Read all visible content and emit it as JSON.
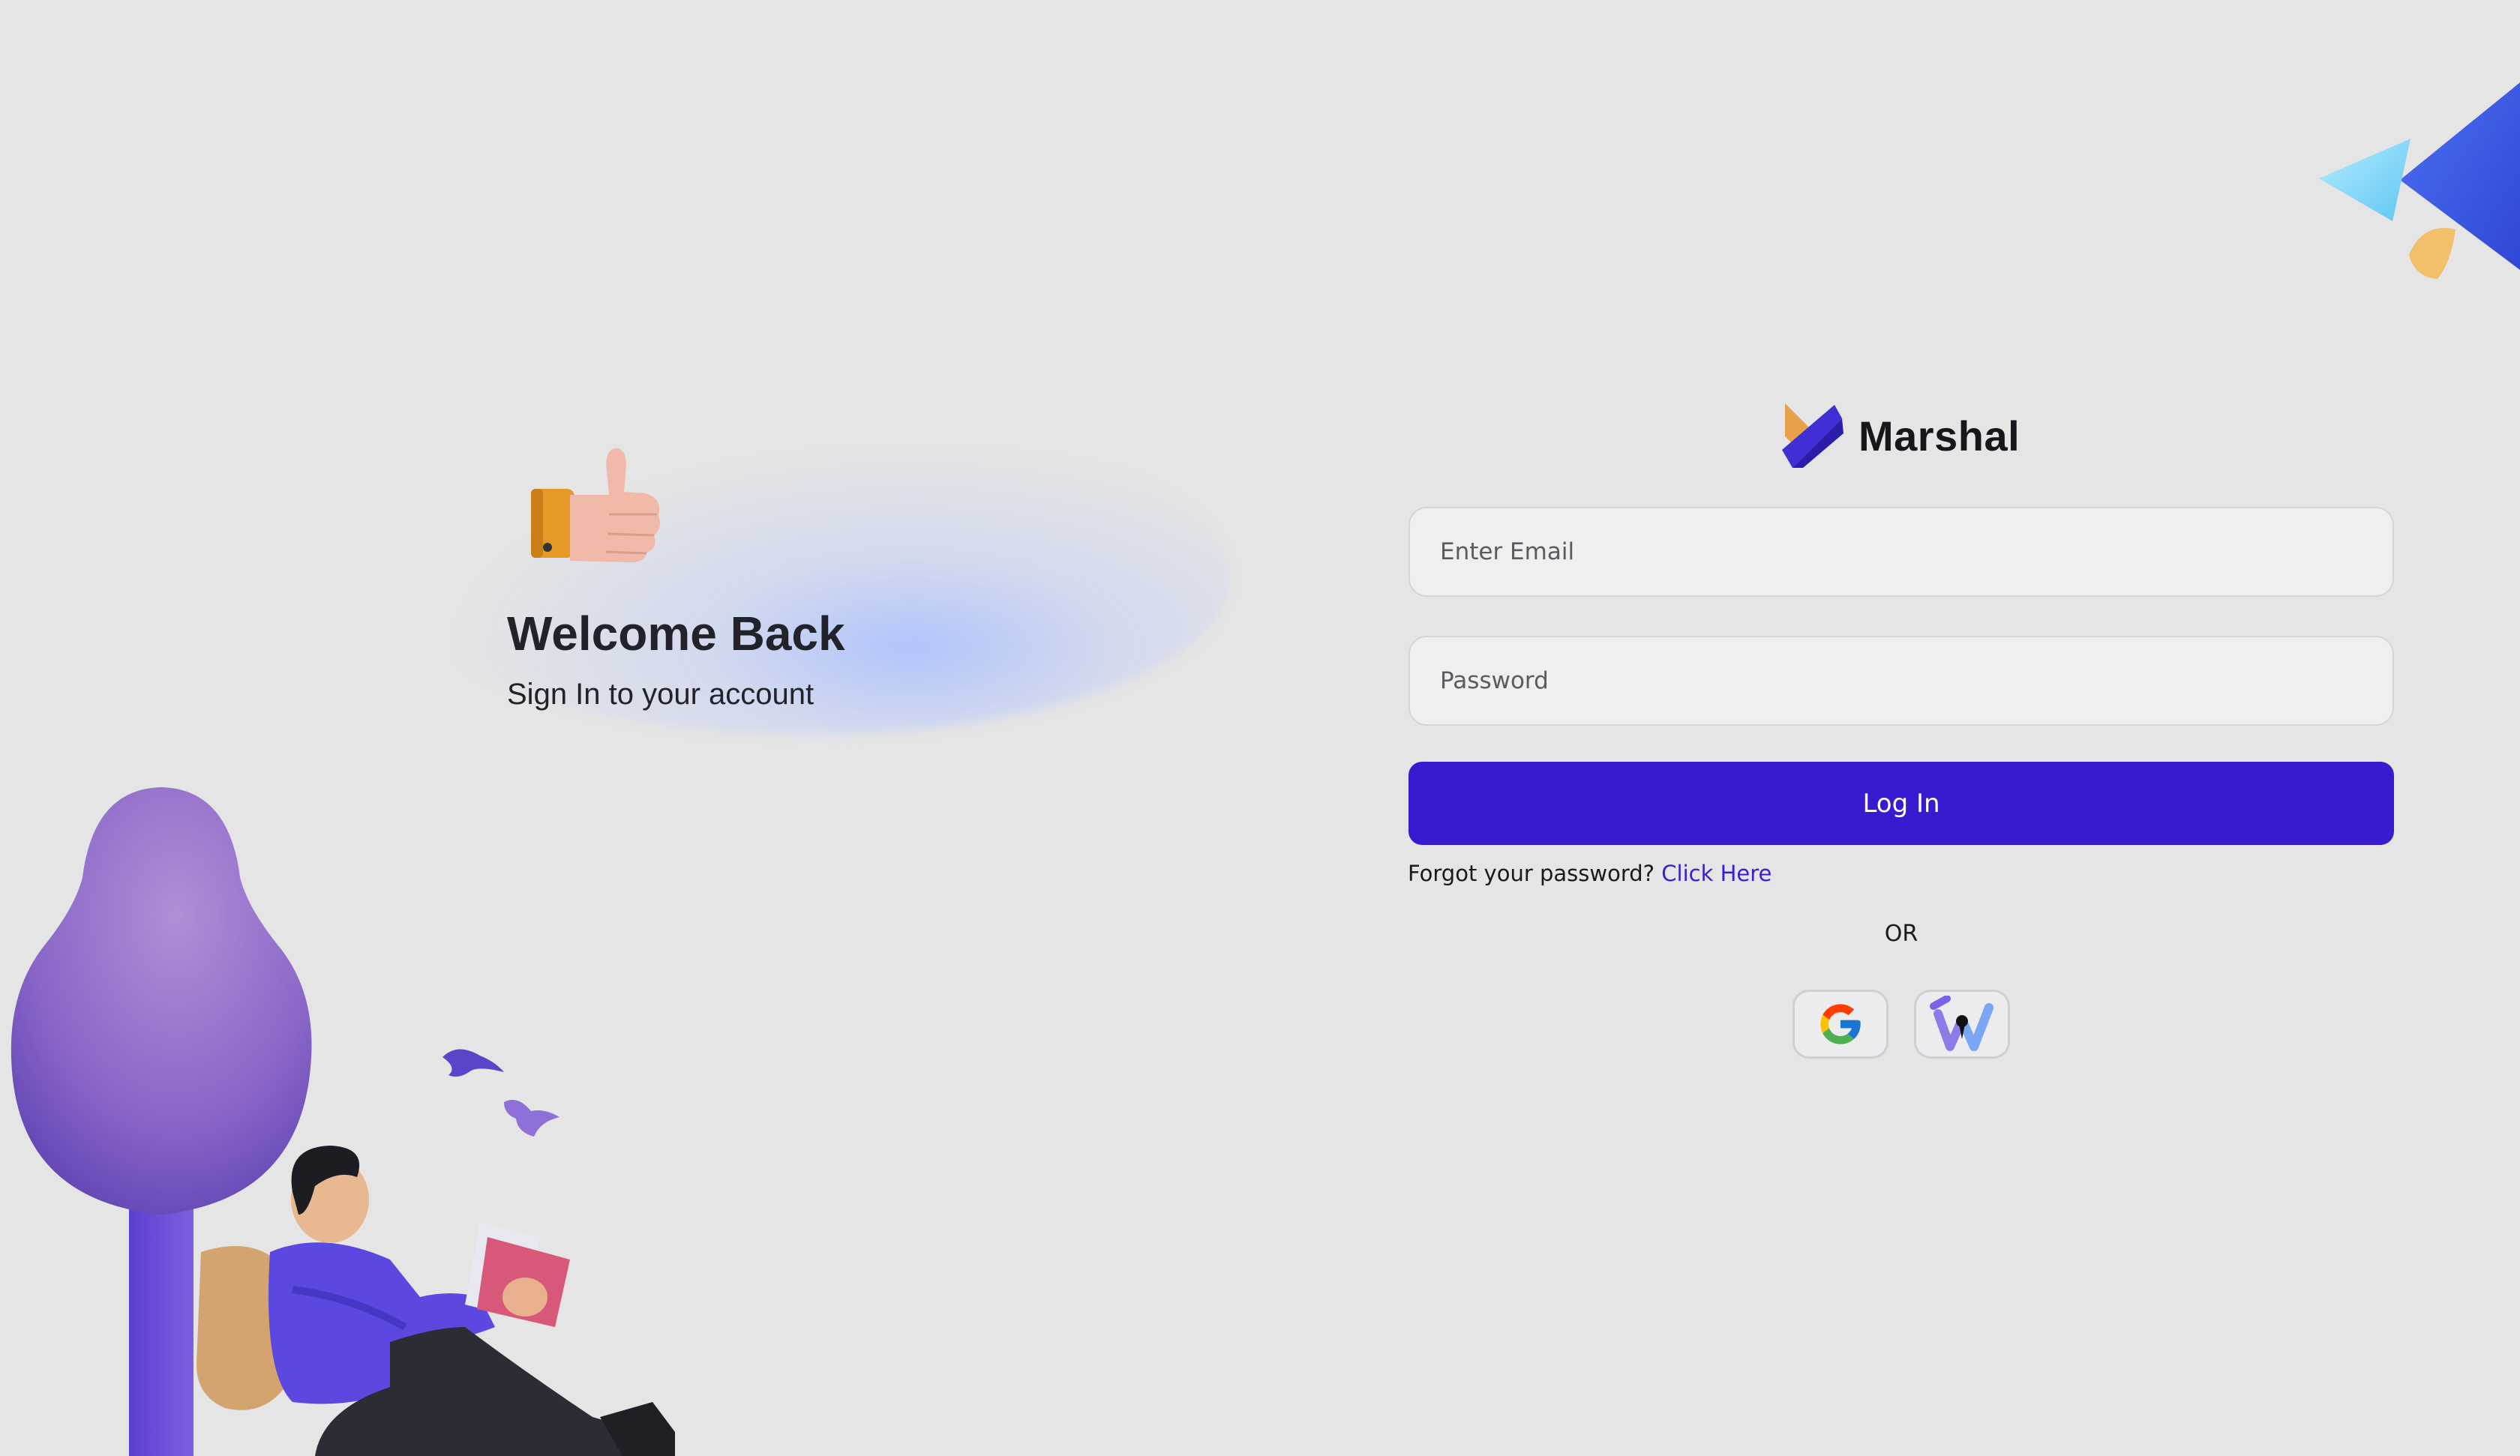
{
  "hero": {
    "title": "Welcome Back",
    "subtitle": "Sign In to your account"
  },
  "brand": {
    "name": "Marshal"
  },
  "form": {
    "email_placeholder": "Enter Email",
    "password_placeholder": "Password",
    "login_label": "Log In",
    "forgot_text": "Forgot your password?",
    "forgot_link": "Click Here",
    "or_text": "OR"
  },
  "social": [
    {
      "icon": "google-icon"
    },
    {
      "icon": "w-logo-icon"
    }
  ],
  "colors": {
    "background": "#e5e5e5",
    "primary": "#391ad1",
    "link": "#3a1ed3",
    "field_bg": "#efeff0"
  }
}
